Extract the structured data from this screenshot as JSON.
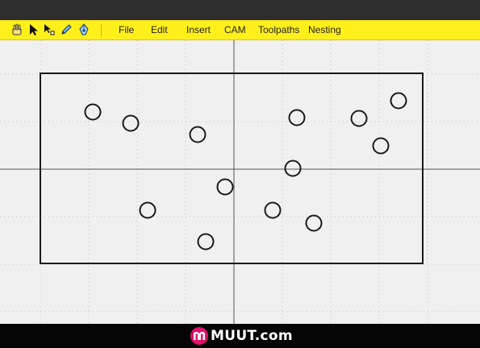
{
  "app": {
    "colors": {
      "titlebar": "#2e2e2e",
      "toolbar": "#ffef1a",
      "canvas_bg": "#f0f0f0",
      "footer": "#050505",
      "brand": "#e0106a"
    }
  },
  "toolbar": {
    "tools": [
      {
        "icon": "hand-pan-icon"
      },
      {
        "icon": "select-arrow-icon"
      },
      {
        "icon": "node-edit-icon"
      },
      {
        "icon": "pencil-icon"
      },
      {
        "icon": "pen-draw-icon"
      }
    ]
  },
  "menu": {
    "items": [
      "File",
      "Edit",
      "Insert",
      "CAM",
      "Toolpaths",
      "Nesting"
    ]
  },
  "footer": {
    "brand_text": "MUUT.com",
    "logo_icon": "muut-logo-icon"
  }
}
